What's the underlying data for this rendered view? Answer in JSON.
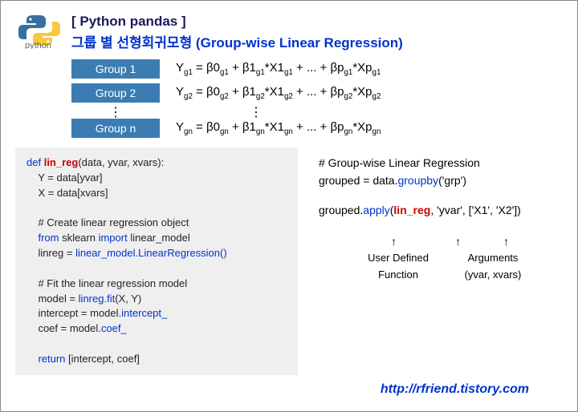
{
  "header": {
    "logo_text": "python",
    "bracket_title": "[ Python pandas ]",
    "main_title": "그룹 별 선형회귀모형 (Group-wise Linear Regression)"
  },
  "groups": {
    "g1_label": "Group 1",
    "g2_label": "Group 2",
    "gn_label": "Group n"
  },
  "code": {
    "def_kw": "def",
    "fn_name": "lin_reg",
    "def_sig": "(data, yvar, xvars):",
    "l1": "    Y = data[yvar]",
    "l2": "    X = data[xvars]",
    "c1": "    # Create linear regression object",
    "from_kw": "from",
    "sklearn": " sklearn ",
    "import_kw": "import",
    "lm": " linear_model",
    "l4a": "    linreg = ",
    "l4b": "linear_model.LinearRegression()",
    "c2": "    # Fit the linear regression model",
    "l5a": "    model = ",
    "l5b": "linreg.fit",
    "l5c": "(X, Y)",
    "l6a": "    intercept = model.",
    "l6b": "intercept_",
    "l7a": "    coef = model.",
    "l7b": "coef_",
    "ret_kw": "return",
    "ret_val": " [intercept, coef]"
  },
  "right": {
    "comment": "# Group-wise Linear Regression",
    "line1a": "grouped = data.",
    "line1b": "groupby",
    "line1c": "('grp')",
    "line2a": "grouped.",
    "line2b": "apply",
    "line2c": "(",
    "line2d": "lin_reg",
    "line2e": ", 'yvar', ['X1', 'X2'])",
    "annot1": "User Defined\nFunction",
    "annot2": "Arguments\n(yvar, xvars)"
  },
  "url": "http://rfriend.tistory.com"
}
